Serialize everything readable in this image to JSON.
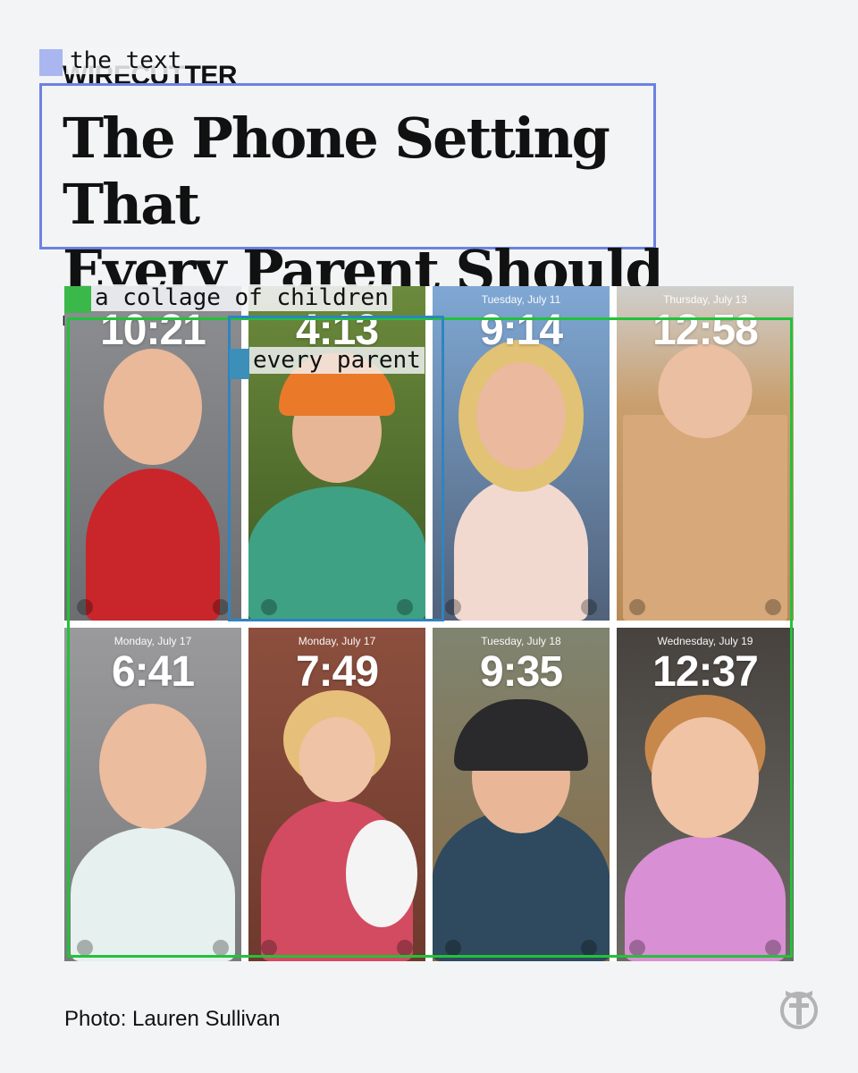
{
  "header": {
    "brand": "WIRECUTTER",
    "headline_line1": "The Phone Setting That",
    "headline_line2": "Every Parent Should Try"
  },
  "annotations": {
    "title_label": "the text",
    "collage_label": "a collage of children",
    "tile_label": "every parent"
  },
  "tiles": [
    {
      "date": "",
      "time": "10:21"
    },
    {
      "date": "",
      "time": "4:13"
    },
    {
      "date": "Tuesday, July 11",
      "time": "9:14"
    },
    {
      "date": "Thursday, July 13",
      "time": "12:58"
    },
    {
      "date": "Monday, July 17",
      "time": "6:41"
    },
    {
      "date": "Monday, July 17",
      "time": "7:49"
    },
    {
      "date": "Tuesday, July 18",
      "time": "9:35"
    },
    {
      "date": "Wednesday, July 19",
      "time": "12:37"
    }
  ],
  "caption": "Photo: Lauren Sullivan",
  "colors": {
    "background": "#f3f4f6",
    "title_box": "#6c82e0",
    "collage_box": "#22c23a",
    "parent_box": "#2f84c0"
  },
  "icons": {
    "publisher_logo": "nyt-t-logo-icon"
  }
}
